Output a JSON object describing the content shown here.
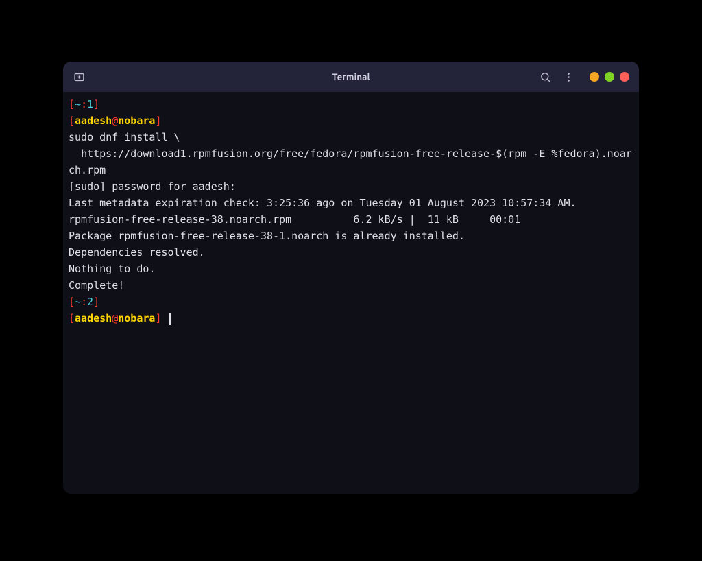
{
  "window": {
    "title": "Terminal"
  },
  "prompt1": {
    "lb1": "[",
    "cwd": "~",
    "colon": ":",
    "num": "1",
    "rb1": "]",
    "lb2": "[",
    "user": "aadesh",
    "at": "@",
    "host": "nobara",
    "rb2": "]"
  },
  "command": {
    "line1": "sudo dnf install \\",
    "line2": "  https://download1.rpmfusion.org/free/fedora/rpmfusion-free-release-$(rpm -E %fedora).noarch.rpm"
  },
  "output": {
    "l1": "[sudo] password for aadesh:",
    "l2": "Last metadata expiration check: 3:25:36 ago on Tuesday 01 August 2023 10:57:34 AM.",
    "l3": "rpmfusion-free-release-38.noarch.rpm          6.2 kB/s |  11 kB     00:01",
    "l4": "Package rpmfusion-free-release-38-1.noarch is already installed.",
    "l5": "Dependencies resolved.",
    "l6": "Nothing to do.",
    "l7": "Complete!"
  },
  "prompt2": {
    "lb1": "[",
    "cwd": "~",
    "colon": ":",
    "num": "2",
    "rb1": "]",
    "lb2": "[",
    "user": "aadesh",
    "at": "@",
    "host": "nobara",
    "rb2": "]"
  }
}
